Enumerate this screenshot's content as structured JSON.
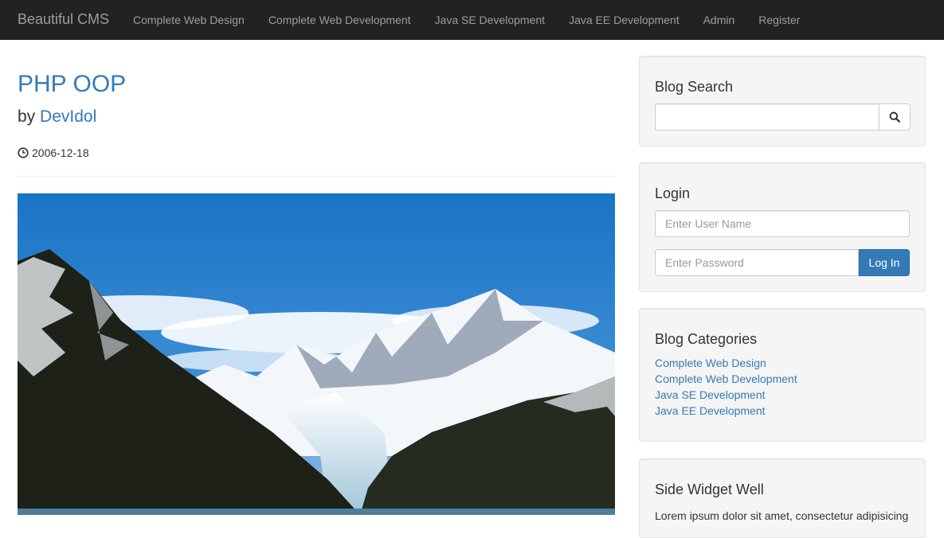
{
  "navbar": {
    "brand": "Beautiful CMS",
    "items": [
      {
        "label": "Complete Web Design"
      },
      {
        "label": "Complete Web Development"
      },
      {
        "label": "Java SE Development"
      },
      {
        "label": "Java EE Development"
      },
      {
        "label": "Admin"
      },
      {
        "label": "Register"
      }
    ]
  },
  "post": {
    "title": "PHP OOP",
    "by_prefix": "by",
    "author": "DevIdol",
    "date_icon": "clock-icon",
    "date": "2006-12-18",
    "image_subject": "mountain-glacier-landscape"
  },
  "sidebar": {
    "search": {
      "heading": "Blog Search",
      "placeholder": "",
      "button_icon": "search-icon"
    },
    "login": {
      "heading": "Login",
      "username_placeholder": "Enter User Name",
      "password_placeholder": "Enter Password",
      "button_label": "Log In"
    },
    "categories": {
      "heading": "Blog Categories",
      "items": [
        {
          "label": "Complete Web Design"
        },
        {
          "label": "Complete Web Development"
        },
        {
          "label": "Java SE Development"
        },
        {
          "label": "Java EE Development"
        }
      ]
    },
    "widget": {
      "heading": "Side Widget Well",
      "text": "Lorem ipsum dolor sit amet, consectetur adipisicing"
    }
  },
  "colors": {
    "navbar_bg": "#222222",
    "link": "#337ab7",
    "primary_button": "#337ab7",
    "well_bg": "#f5f5f5"
  }
}
